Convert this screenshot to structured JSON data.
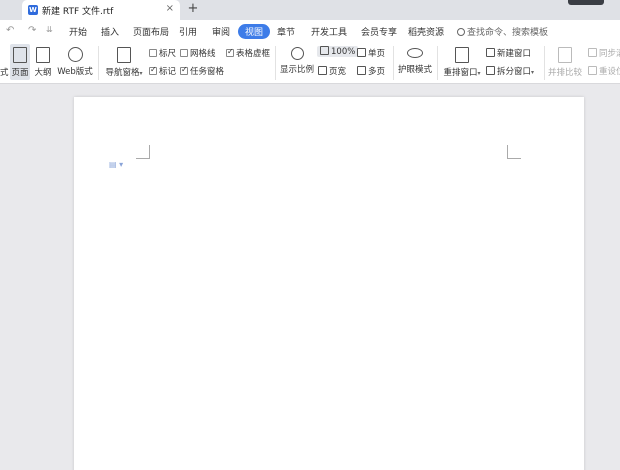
{
  "tabstrip": {
    "doc_title": "新建 RTF 文件.rtf",
    "app_badge": "W",
    "close_glyph": "×",
    "new_tab_glyph": "+"
  },
  "quick_access": {
    "undo_glyph": "↶",
    "redo_glyph": "↷",
    "more_glyph": "⇊"
  },
  "menu": {
    "items": [
      "开始",
      "插入",
      "页面布局",
      "引用",
      "审阅",
      "视图",
      "章节",
      "开发工具",
      "会员专享",
      "稻壳资源"
    ],
    "active": "视图",
    "search_placeholder": "查找命令、搜索模板"
  },
  "ribbon": {
    "clipped_left": "式",
    "view_modes": {
      "page": "页面",
      "outline": "大纲",
      "web": "Web版式"
    },
    "nav_pane": "导航窗格",
    "checks": {
      "ruler": {
        "label": "标尺",
        "checked": false
      },
      "gridlines": {
        "label": "网格线",
        "checked": false
      },
      "table_gridlines": {
        "label": "表格虚框",
        "checked": true
      },
      "marks": {
        "label": "标记",
        "checked": true
      },
      "task_pane": {
        "label": "任务窗格",
        "checked": true
      }
    },
    "zoom": {
      "display_ratio": "显示比例",
      "hundred": "100%",
      "page_width": "页宽",
      "one_page": "单页",
      "multi_page": "多页"
    },
    "eye_mode": "护眼模式",
    "window": {
      "rearrange": "重排窗口",
      "new_window": "新建窗口",
      "split_window": "拆分窗口"
    },
    "compare": {
      "side_by_side": "并排比较",
      "sync_scroll": "同步滚",
      "reset_position": "重设位"
    }
  },
  "colors": {
    "accent": "#3d7ce8",
    "tabstrip_bg": "#dfe1e6",
    "workspace_bg": "#e9e9ec"
  }
}
